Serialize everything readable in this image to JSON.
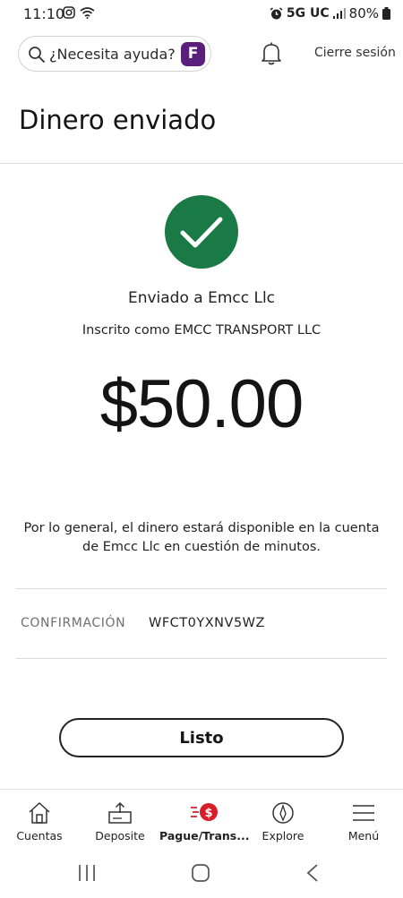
{
  "status_bar": {
    "time": "11:10",
    "network": "5G UC",
    "battery": "80%"
  },
  "header": {
    "search_text": "¿Necesita ayuda?",
    "assistant_badge": "F",
    "logout_label": "Cierre sesión"
  },
  "page": {
    "title": "Dinero enviado"
  },
  "confirmation": {
    "sent_to": "Enviado a Emcc Llc",
    "enrolled_as": "Inscrito como EMCC TRANSPORT LLC",
    "amount": "$50.00",
    "availability_message": "Por lo general, el dinero estará disponible en la cuenta de Emcc Llc en cuestión de minutos.",
    "confirmation_label": "CONFIRMACIÓN",
    "confirmation_number": "WFCT0YXNV5WZ",
    "done_label": "Listo",
    "accent_color": "#1a7a45"
  },
  "bottom_nav": {
    "items": [
      {
        "label": "Cuentas",
        "icon": "home-icon"
      },
      {
        "label": "Deposite",
        "icon": "deposit-icon"
      },
      {
        "label": "Pague/Trans...",
        "icon": "pay-transfer-icon",
        "active": true
      },
      {
        "label": "Explore",
        "icon": "compass-icon"
      },
      {
        "label": "Menú",
        "icon": "menu-icon"
      }
    ]
  }
}
